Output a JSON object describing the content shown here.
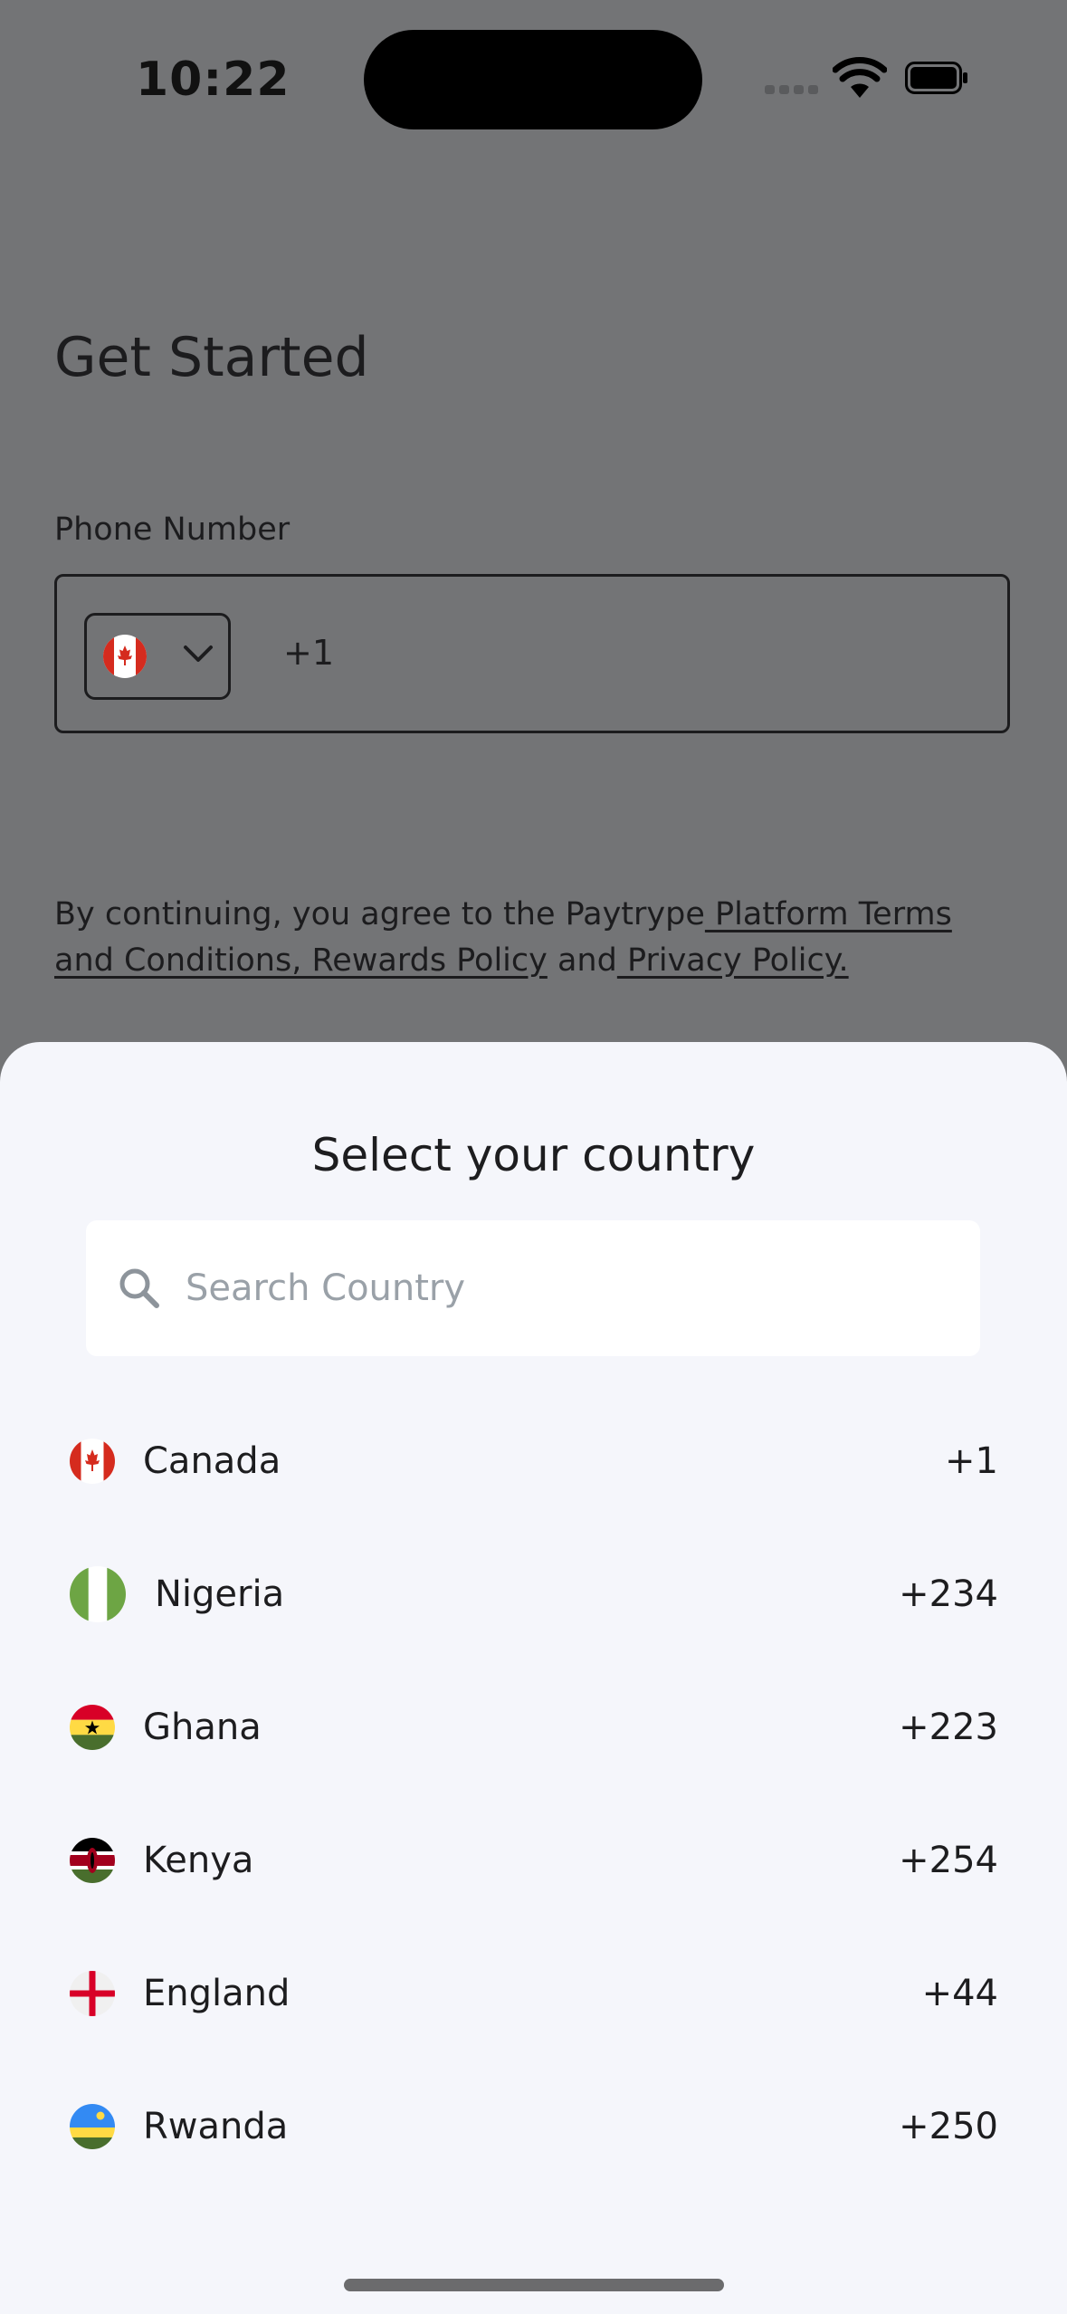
{
  "status_bar": {
    "time": "10:22"
  },
  "page": {
    "title": "Get Started",
    "phone_label": "Phone Number",
    "selected_flag": "canada-flag-icon",
    "dial_code": "+1",
    "terms": {
      "prefix": "By continuing, you agree to the Paytrype",
      "link_terms": " Platform Terms and Conditions, Rewards Policy",
      "connector": " and",
      "link_privacy": " Privacy Policy."
    }
  },
  "sheet": {
    "title": "Select your country",
    "search_placeholder": "Search Country",
    "countries": [
      {
        "name": "Canada",
        "code": "+1",
        "flag": "canada-flag-icon"
      },
      {
        "name": "Nigeria",
        "code": "+234",
        "flag": "nigeria-flag-icon"
      },
      {
        "name": "Ghana",
        "code": "+223",
        "flag": "ghana-flag-icon"
      },
      {
        "name": "Kenya",
        "code": "+254",
        "flag": "kenya-flag-icon"
      },
      {
        "name": "England",
        "code": "+44",
        "flag": "england-flag-icon"
      },
      {
        "name": "Rwanda",
        "code": "+250",
        "flag": "rwanda-flag-icon"
      }
    ]
  },
  "colors": {
    "overlay_background": "#737476",
    "sheet_background": "#f5f6fb",
    "placeholder": "#9aa1a8"
  }
}
